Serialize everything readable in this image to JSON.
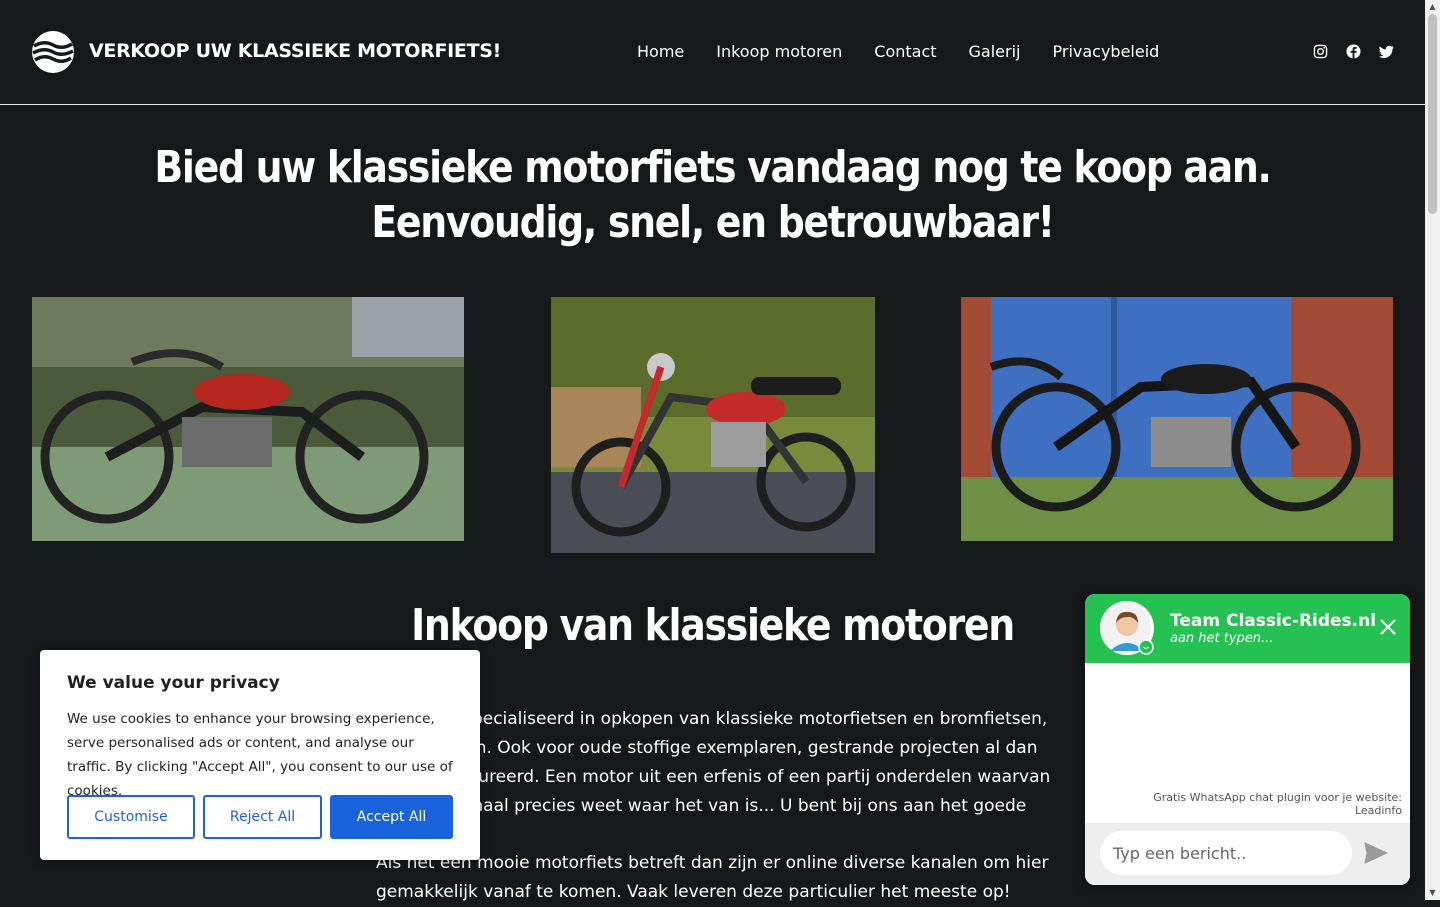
{
  "header": {
    "site_title": "VERKOOP UW KLASSIEKE MOTORFIETS!",
    "nav": [
      "Home",
      "Inkoop motoren",
      "Contact",
      "Galerij",
      "Privacybeleid"
    ],
    "social_icons": [
      "instagram-icon",
      "facebook-icon",
      "twitter-icon"
    ]
  },
  "hero": {
    "title_line1": "Bied uw klassieke motorfiets vandaag nog te koop aan.",
    "title_line2": "Eenvoudig, snel, en betrouwbaar!"
  },
  "section": {
    "title": "Inkoop van klassieke motoren",
    "paragraph1": "Wij zijn gespecialiseerd in opkopen van klassieke motorfietsen en bromfietsen, in alle staten. Ook voor oude stoffige exemplaren, gestrande projecten al dan niet gerestaureerd. Een motor uit een erfenis of een partij onderdelen waarvan u niet helemaal precies weet waar het van is... U bent bij ons aan het goede adres!",
    "paragraph2": "Als het een mooie motorfiets betreft dan zijn er online diverse kanalen om hier gemakkelijk vanaf te komen. Vaak leveren deze particulier het meeste op!"
  },
  "cookie": {
    "title": "We value your privacy",
    "text": "We use cookies to enhance your browsing experience, serve personalised ads or content, and analyse our traffic. By clicking \"Accept All\", you consent to our use of cookies.",
    "customise": "Customise",
    "reject": "Reject All",
    "accept": "Accept All"
  },
  "whatsapp": {
    "name": "Team Classic-Rides.nl",
    "status": "aan het typen...",
    "credit_line1": "Gratis WhatsApp chat plugin voor je website:",
    "credit_line2": "Leadinfo",
    "input_placeholder": "Typ een bericht..",
    "accent": "#25c152"
  },
  "colors": {
    "background": "#17181a",
    "cookie_accent": "#1863dc"
  }
}
